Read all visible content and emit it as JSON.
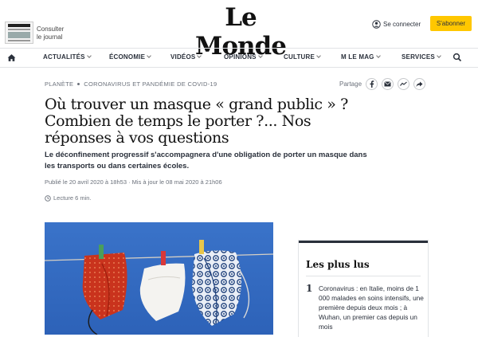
{
  "header": {
    "consult_line1": "Consulter",
    "consult_line2": "le journal",
    "logo": "Le Monde",
    "connect": "Se connecter",
    "subscribe": "S'abonner"
  },
  "nav": {
    "items": [
      "ACTUALITÉS",
      "ÉCONOMIE",
      "VIDÉOS",
      "OPINIONS",
      "CULTURE",
      "M LE MAG",
      "SERVICES"
    ]
  },
  "article": {
    "section": "PLANÈTE",
    "subsection": "CORONAVIRUS ET PANDÉMIE DE COVID-19",
    "share_label": "Partage",
    "title": "Où trouver un masque « grand public » ? Combien de temps le porter ?... Nos réponses à vos questions",
    "description": "Le déconfinement progressif s'accompagnera d'une obligation de porter un masque dans les transports ou dans certaines écoles.",
    "published": "Publié le 20 avril 2020 à 18h53 · Mis à jour le 08 mai 2020 à 21h06",
    "reading_time": "Lecture 6 min."
  },
  "sidebar": {
    "title": "Les plus lus",
    "items": [
      {
        "rank": "1",
        "text": "Coronavirus : en Italie, moins de 1 000 malades en soins intensifs, une première depuis deux mois ; à Wuhan, un premier cas depuis un mois"
      }
    ]
  },
  "colors": {
    "accent": "#ffc700",
    "text": "#2a303b"
  },
  "icons": [
    "home-icon",
    "search-icon",
    "user-icon",
    "facebook-icon",
    "mail-icon",
    "messenger-icon",
    "share-icon",
    "clock-icon"
  ]
}
